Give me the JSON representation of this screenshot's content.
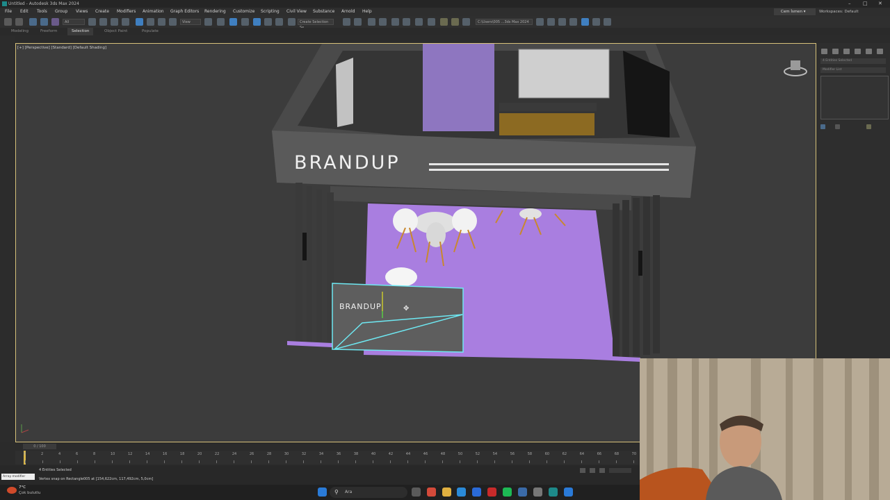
{
  "window": {
    "title": "Untitled - Autodesk 3ds Max 2024"
  },
  "menu": [
    "File",
    "Edit",
    "Tools",
    "Group",
    "Views",
    "Create",
    "Modifiers",
    "Animation",
    "Graph Editors",
    "Rendering",
    "Customize",
    "Scripting",
    "Civil View",
    "Substance",
    "Arnold",
    "Help"
  ],
  "account": {
    "user": "Cem İsmen",
    "workspaces_label": "Workspaces:",
    "workspace": "Default"
  },
  "toolbar": {
    "filter": "All",
    "view_dropdown": "View",
    "selection_set": "Create Selection Se",
    "project_path": "C:\\Users\\005 ...3ds Max 2024"
  },
  "ribbon": {
    "tabs": [
      "Modeling",
      "Freeform",
      "Selection",
      "Object Paint",
      "Populate"
    ],
    "active": "Selection"
  },
  "viewport": {
    "label": "[+] [Perspective] [Standard] [Default Shading]",
    "brand_text": "BRANDUP",
    "counter_text": "BRANDUP"
  },
  "command_panel": {
    "selection_info": "4 Entities Selected",
    "modifier_list": "Modifier List"
  },
  "timeline": {
    "frame": "0 / 100",
    "ticks": [
      "0",
      "2",
      "4",
      "6",
      "8",
      "10",
      "12",
      "14",
      "16",
      "18",
      "20",
      "22",
      "24",
      "26",
      "28",
      "30",
      "32",
      "34",
      "36",
      "38",
      "40",
      "42",
      "44",
      "46",
      "48",
      "50",
      "52",
      "54",
      "56",
      "58",
      "60",
      "62",
      "64",
      "66",
      "68",
      "70"
    ],
    "current_frame": 0
  },
  "status": {
    "selected": "4 Entities Selected",
    "prompt": "Vertex snap on Rectangle005 at [154,622cm, 117,492cm, 5,0cm]",
    "maxscript": "Array modifier"
  },
  "weather": {
    "temp": "7°C",
    "desc": "Çok bulutlu"
  },
  "taskbar": {
    "search_placeholder": "Ara"
  }
}
